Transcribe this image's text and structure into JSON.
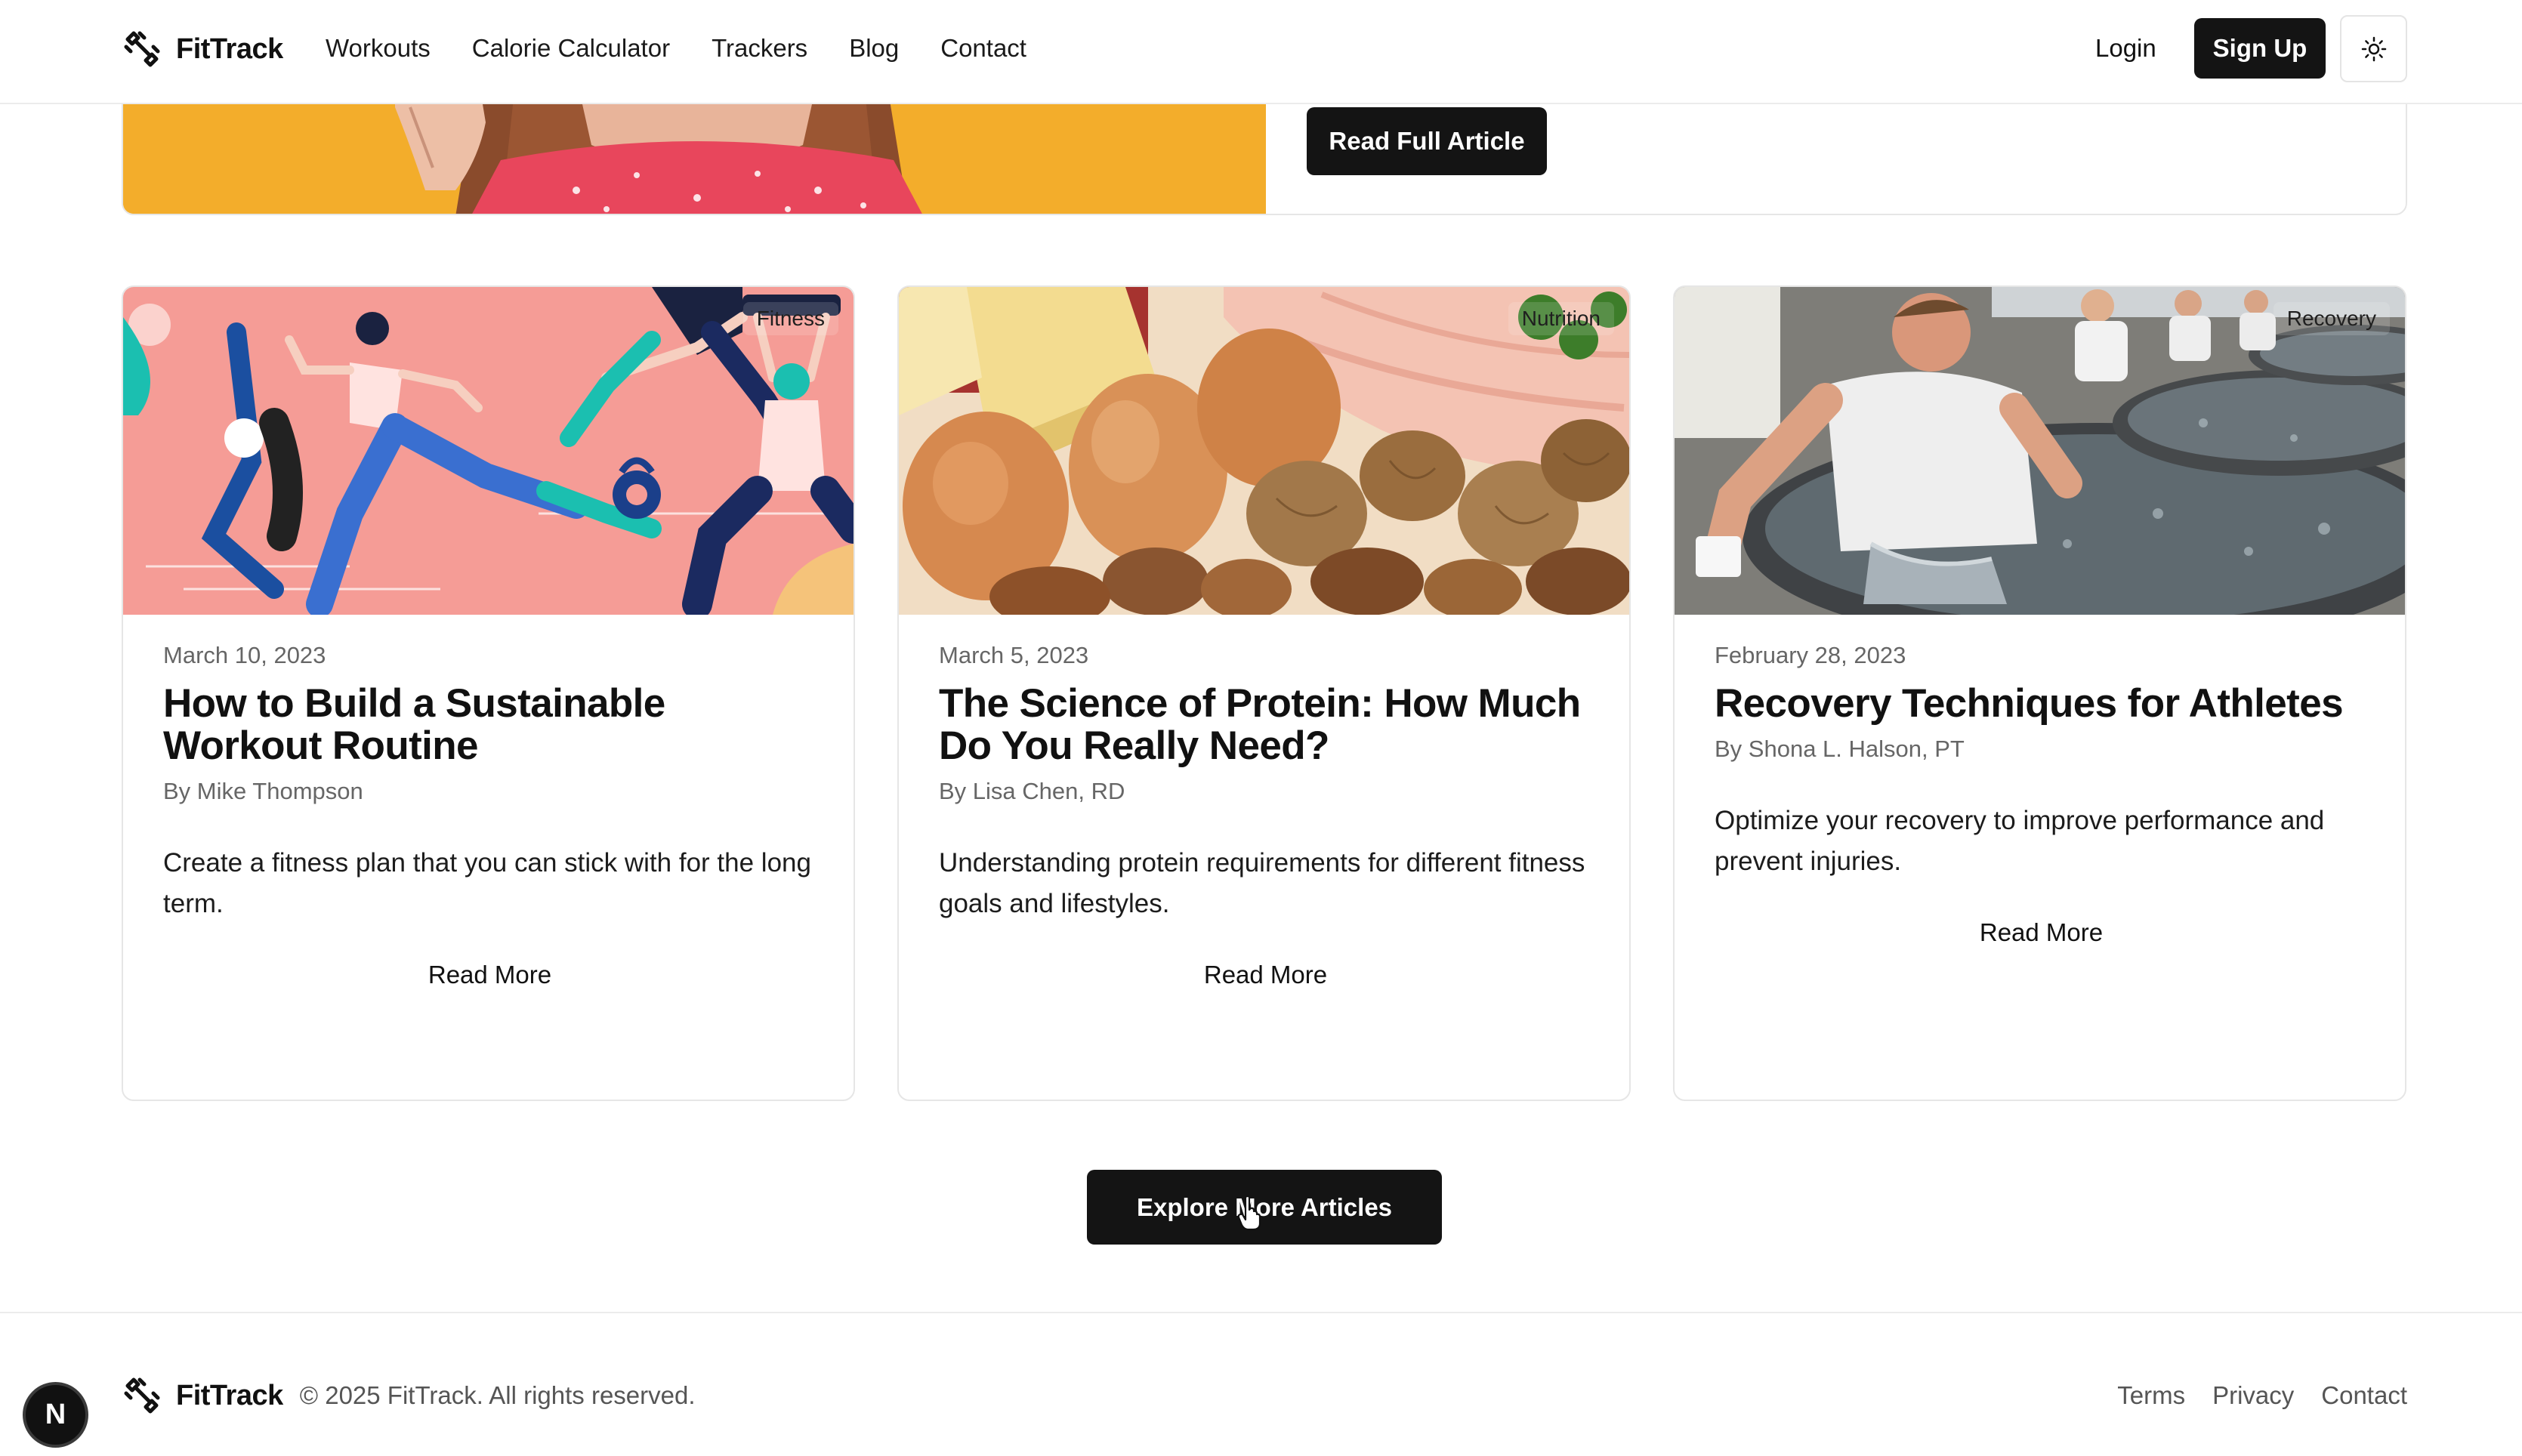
{
  "header": {
    "brand": "FitTrack",
    "nav": [
      "Workouts",
      "Calorie Calculator",
      "Trackers",
      "Blog",
      "Contact"
    ],
    "login_label": "Login",
    "signup_label": "Sign Up",
    "theme_toggle_icon": "sun-icon"
  },
  "featured": {
    "read_full_label": "Read Full Article"
  },
  "articles": [
    {
      "tag": "Fitness",
      "date": "March 10, 2023",
      "title": "How to Build a Sustainable Workout Routine",
      "author": "By Mike Thompson",
      "excerpt": "Create a fitness plan that you can stick with for the long term.",
      "cta": "Read More"
    },
    {
      "tag": "Nutrition",
      "date": "March 5, 2023",
      "title": "The Science of Protein: How Much Do You Really Need?",
      "author": "By Lisa Chen, RD",
      "excerpt": "Understanding protein requirements for different fitness goals and lifestyles.",
      "cta": "Read More"
    },
    {
      "tag": "Recovery",
      "date": "February 28, 2023",
      "title": "Recovery Techniques for Athletes",
      "author": "By Shona L. Halson, PT",
      "excerpt": "Optimize your recovery to improve performance and prevent injuries.",
      "cta": "Read More"
    }
  ],
  "explore_label": "Explore More Articles",
  "footer": {
    "brand": "FitTrack",
    "copyright": "© 2025 FitTrack. All rights reserved.",
    "links": [
      "Terms",
      "Privacy",
      "Contact"
    ]
  },
  "dev_badge_letter": "N",
  "colors": {
    "primary_button": "#141414",
    "featured_background": "#f5b32f",
    "fitness_card_background": "#f59c96"
  }
}
